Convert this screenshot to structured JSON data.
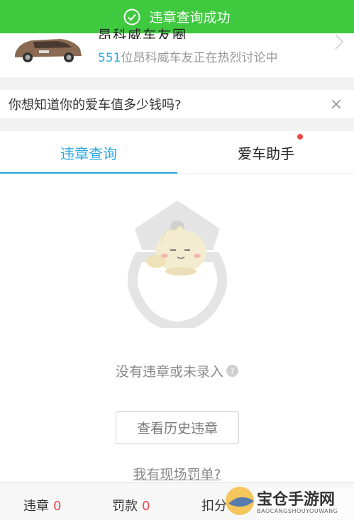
{
  "banner": {
    "text": "违章查询成功"
  },
  "car": {
    "title": "昂科威车友圈",
    "count": "551",
    "desc_suffix": "位昂科威车友正在热烈讨论中"
  },
  "value_prompt": {
    "text": "你想知道你的爱车值多少钱吗?",
    "close": "×"
  },
  "tabs": [
    {
      "label": "违章查询"
    },
    {
      "label": "爱车助手"
    }
  ],
  "empty": {
    "text": "没有违章或未录入",
    "help": "?"
  },
  "history_button": {
    "label": "查看历史违章"
  },
  "onsite_link": {
    "label": "我有现场罚单?"
  },
  "stats": [
    {
      "label": "违章",
      "value": "0"
    },
    {
      "label": "罚款",
      "value": "0"
    },
    {
      "label": "扣分",
      "value": ""
    }
  ],
  "watermark": {
    "title": "宝仓手游网",
    "sub": "BAOCANGSHOUYOUWANG"
  },
  "colors": {
    "accent": "#2aa8e0",
    "success": "#3fc93f",
    "alert": "#f04848"
  }
}
